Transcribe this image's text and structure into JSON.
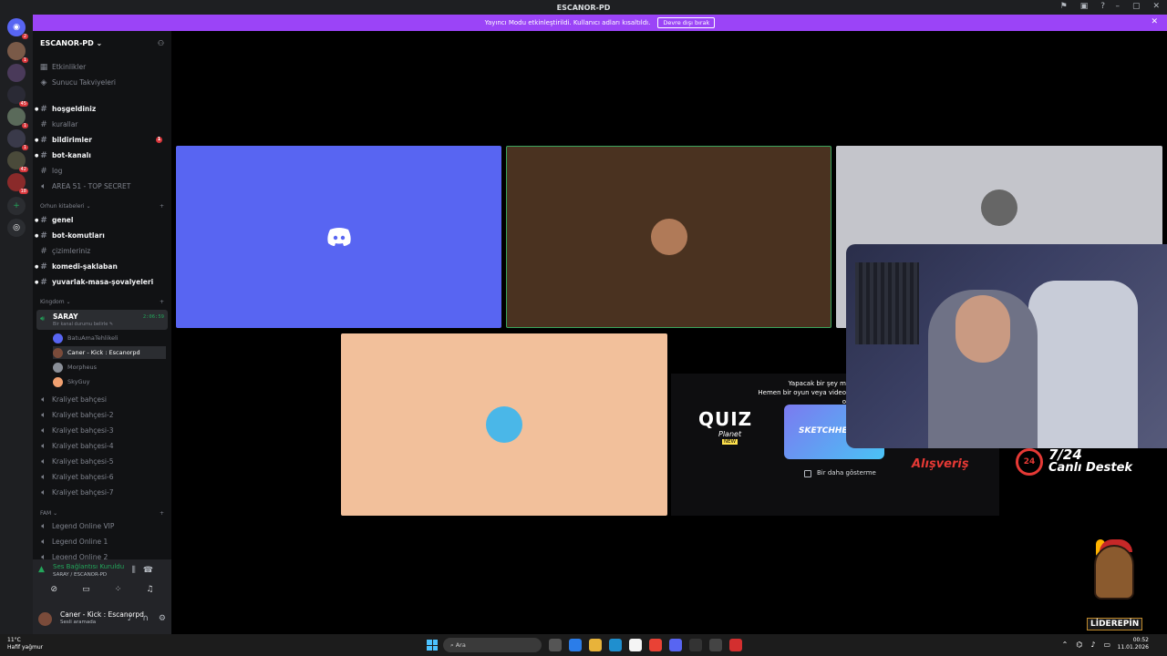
{
  "window": {
    "title": "ESCANOR-PD"
  },
  "banner": {
    "text": "Yayıncı Modu etkinleştirildi. Kullanıcı adları kısaltıldı.",
    "button": "Devre dışı bırak"
  },
  "guild_badges": [
    "2",
    "1",
    "45",
    "1",
    "1",
    "42",
    "18",
    "1"
  ],
  "server": {
    "name": "ESCANOR-PD ⌄"
  },
  "top_items": [
    {
      "label": "Etkinlikler"
    },
    {
      "label": "Sunucu Takviyeleri"
    }
  ],
  "channels_a": [
    {
      "label": "hoşgeldiniz",
      "bold": true
    },
    {
      "label": "kurallar",
      "bold": false
    },
    {
      "label": "bildirimler",
      "bold": true,
      "notif": "1"
    },
    {
      "label": "bot-kanalı",
      "bold": true
    },
    {
      "label": "log",
      "bold": false
    },
    {
      "label": "AREA 51 - TOP SECRET",
      "bold": false,
      "voice": true
    }
  ],
  "cat_orhun": "Orhun kitabeleri ⌄",
  "channels_b": [
    {
      "label": "genel",
      "bold": true
    },
    {
      "label": "bot-komutları",
      "bold": true
    },
    {
      "label": "çizimleriniz",
      "bold": false
    },
    {
      "label": "komedi-şaklaban",
      "bold": true
    },
    {
      "label": "yuvarlak-masa-şovalyeleri",
      "bold": true
    }
  ],
  "cat_kingdom": "Kingdom ⌄",
  "voice_active": {
    "name": "SARAY",
    "sub": "Bir kanal durumu belirle ✎",
    "time": "2:06:59"
  },
  "voice_users": [
    {
      "name": "BatuAmaTehlikeli",
      "color": "#5865f2"
    },
    {
      "name": "Caner - Kick : Escanorpd",
      "color": "#7a4b3a",
      "active": true
    },
    {
      "name": "Morpheus",
      "color": "#8a8f98"
    },
    {
      "name": "SkyGuy",
      "color": "#f0a070"
    }
  ],
  "channels_c": [
    "Kraliyet bahçesi",
    "Kraliyet bahçesi-2",
    "Kraliyet bahçesi-3",
    "Kraliyet bahçesi-4",
    "Kraliyet bahçesi-5",
    "Kraliyet bahçesi-6",
    "Kraliyet bahçesi-7"
  ],
  "cat_fam": "FAM ⌄",
  "channels_d": [
    "Legend Online VIP",
    "Legend Online 1",
    "Legend Online 2"
  ],
  "connection": {
    "status": "Ses Bağlantısı Kuruldu",
    "location": "SARAY / ESCANOR-PD"
  },
  "user": {
    "name": "Caner - Kick : Escanorpd",
    "status": "Sesli aramada"
  },
  "tiles": [
    {
      "bg": "#5865f2"
    },
    {
      "bg": "#4a3220",
      "border": "#3ba55d"
    },
    {
      "bg": "#c4c5cb"
    },
    {
      "bg": "#f2c09b"
    }
  ],
  "shop": {
    "msg": "Yapacak bir şey m\nHemen bir oyun veya video o",
    "quiz": "QUIZ",
    "planet": "Planet",
    "new": "NEW",
    "sketch": "SKETCHHE",
    "dont_show": "Bir daha gösterme"
  },
  "overlay": {
    "shop": "Alışveriş",
    "support_top": "7/24",
    "support_bottom": "Canlı Destek",
    "support_badge": "24",
    "brand": "LİDEREPİN"
  },
  "taskbar": {
    "temp": "11°C",
    "weather": "Hafif yağmur",
    "search": "Ara",
    "time": "00:52",
    "date": "11.01.2026"
  }
}
